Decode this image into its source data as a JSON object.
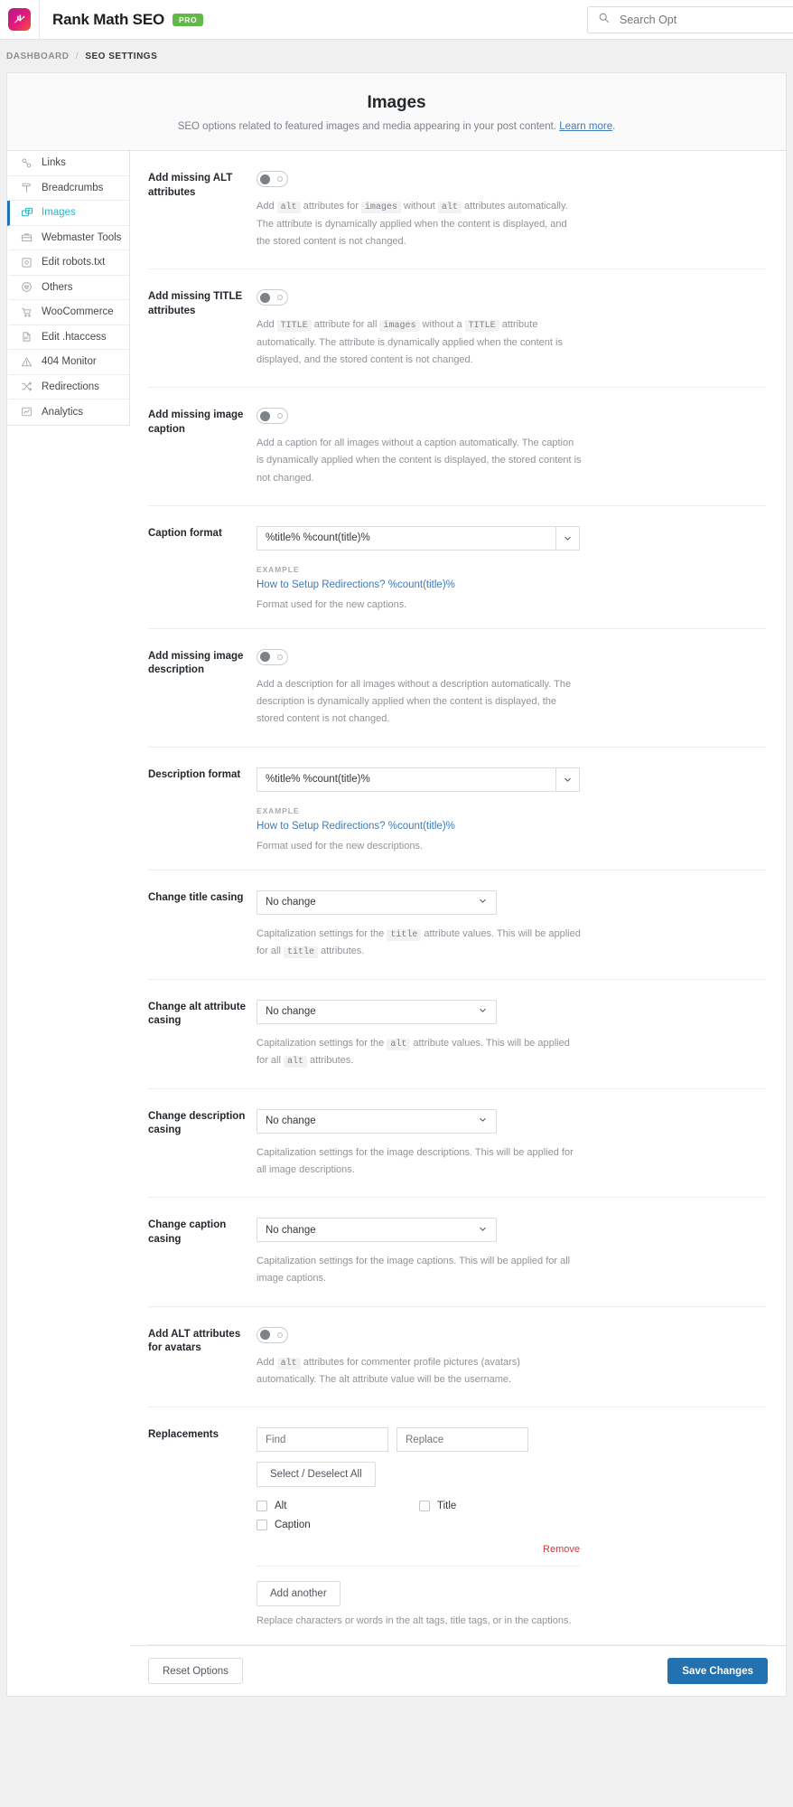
{
  "header": {
    "brand": "Rank Math SEO",
    "pro_badge": "PRO",
    "logo_icon": "rank-math-logo-icon",
    "search_placeholder": "Search Opt"
  },
  "breadcrumb": {
    "root": "DASHBOARD",
    "separator": "/",
    "current": "SEO SETTINGS"
  },
  "page": {
    "title": "Images",
    "subtitle": "SEO options related to featured images and media appearing in your post content.",
    "learn_more": "Learn more",
    "learn_more_suffix": "."
  },
  "sidebar": {
    "items": [
      {
        "label": "Links",
        "icon": "link-icon",
        "active": false
      },
      {
        "label": "Breadcrumbs",
        "icon": "signpost-icon",
        "active": false
      },
      {
        "label": "Images",
        "icon": "image-plus-icon",
        "active": true
      },
      {
        "label": "Webmaster Tools",
        "icon": "toolbox-icon",
        "active": false
      },
      {
        "label": "Edit robots.txt",
        "icon": "robot-file-icon",
        "active": false
      },
      {
        "label": "Others",
        "icon": "list-circle-icon",
        "active": false
      },
      {
        "label": "WooCommerce",
        "icon": "cart-icon",
        "active": false
      },
      {
        "label": "Edit .htaccess",
        "icon": "file-icon",
        "active": false
      },
      {
        "label": "404 Monitor",
        "icon": "warning-triangle-icon",
        "active": false
      },
      {
        "label": "Redirections",
        "icon": "shuffle-icon",
        "active": false
      },
      {
        "label": "Analytics",
        "icon": "chart-line-icon",
        "active": false
      }
    ]
  },
  "fields": {
    "alt": {
      "label": "Add missing ALT attributes",
      "toggle_state": "off",
      "desc_1": "Add ",
      "desc_tok_1": "alt",
      "desc_2": " attributes for ",
      "desc_tok_2": "images",
      "desc_3": " without ",
      "desc_tok_3": "alt",
      "desc_4": " attributes automatically. The attribute is dynamically applied when the content is displayed, and the stored content is not changed."
    },
    "title_attr": {
      "label": "Add missing TITLE attributes",
      "toggle_state": "off",
      "desc_1": "Add ",
      "desc_tok_1": "TITLE",
      "desc_2": " attribute for all ",
      "desc_tok_2": "images",
      "desc_3": " without a ",
      "desc_tok_3": "TITLE",
      "desc_4": " attribute automatically. The attribute is dynamically applied when the content is displayed, and the stored content is not changed."
    },
    "caption": {
      "label": "Add missing image caption",
      "toggle_state": "off",
      "desc": "Add a caption for all images without a caption automatically. The caption is dynamically applied when the content is displayed, the stored content is not changed."
    },
    "caption_format": {
      "label": "Caption format",
      "value": "%title% %count(title)%",
      "example_label": "EXAMPLE",
      "example_value": "How to Setup Redirections? %count(title)%",
      "hint": "Format used for the new captions.",
      "dropdown_icon": "chevron-down-icon"
    },
    "description": {
      "label": "Add missing image description",
      "toggle_state": "off",
      "desc": "Add a description for all images without a description automatically. The description is dynamically applied when the content is displayed, the stored content is not changed."
    },
    "description_format": {
      "label": "Description format",
      "value": "%title% %count(title)%",
      "example_label": "EXAMPLE",
      "example_value": "How to Setup Redirections? %count(title)%",
      "hint": "Format used for the new descriptions.",
      "dropdown_icon": "chevron-down-icon"
    },
    "title_casing": {
      "label": "Change title casing",
      "value": "No change",
      "desc_1": "Capitalization settings for the ",
      "desc_tok_1": "title",
      "desc_2": " attribute values. This will be applied for all ",
      "desc_tok_2": "title",
      "desc_3": " attributes."
    },
    "alt_casing": {
      "label": "Change alt attribute casing",
      "value": "No change",
      "desc_1": "Capitalization settings for the ",
      "desc_tok_1": "alt",
      "desc_2": " attribute values. This will be applied for all ",
      "desc_tok_2": "alt",
      "desc_3": " attributes."
    },
    "description_casing": {
      "label": "Change description casing",
      "value": "No change",
      "desc": "Capitalization settings for the image descriptions. This will be applied for all image descriptions."
    },
    "caption_casing": {
      "label": "Change caption casing",
      "value": "No change",
      "desc": "Capitalization settings for the image captions. This will be applied for all image captions."
    },
    "avatars": {
      "label": "Add ALT attributes for avatars",
      "toggle_state": "off",
      "desc_1": "Add ",
      "desc_tok_1": "alt",
      "desc_2": " attributes for commenter profile pictures (avatars) automatically. The alt attribute value will be the username."
    },
    "replacements": {
      "label": "Replacements",
      "find_placeholder": "Find",
      "find_value": "",
      "replace_placeholder": "Replace",
      "replace_value": "",
      "select_all_label": "Select / Deselect All",
      "checkboxes": [
        {
          "label": "Alt",
          "checked": false
        },
        {
          "label": "Title",
          "checked": false
        },
        {
          "label": "Caption",
          "checked": false
        }
      ],
      "remove_label": "Remove",
      "add_another_label": "Add another",
      "hint": "Replace characters or words in the alt tags, title tags, or in the captions."
    }
  },
  "footer": {
    "reset_label": "Reset Options",
    "save_label": "Save Changes"
  },
  "colors": {
    "accent": "#2271b1",
    "active_sidebar": "#2bb6c8",
    "pro_badge": "#62b948",
    "link": "#3b7cbd",
    "danger": "#d63638"
  },
  "select_options": [
    "No change"
  ]
}
